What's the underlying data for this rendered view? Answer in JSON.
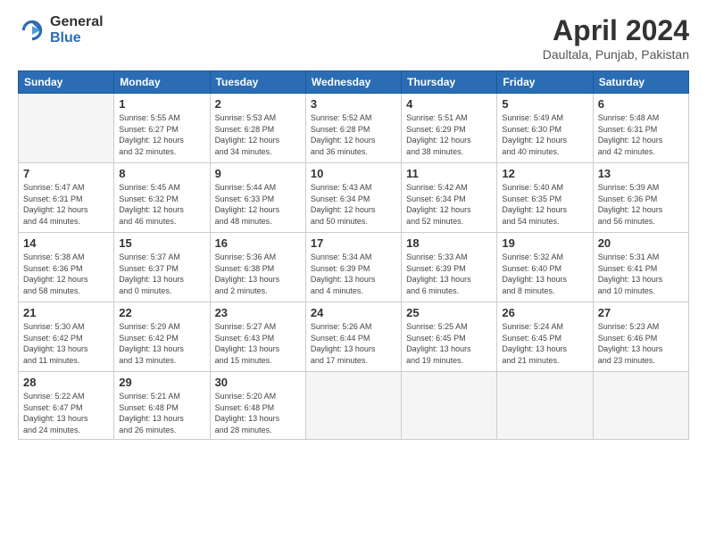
{
  "logo": {
    "general": "General",
    "blue": "Blue"
  },
  "header": {
    "title": "April 2024",
    "location": "Daultala, Punjab, Pakistan"
  },
  "weekdays": [
    "Sunday",
    "Monday",
    "Tuesday",
    "Wednesday",
    "Thursday",
    "Friday",
    "Saturday"
  ],
  "weeks": [
    [
      {
        "day": "",
        "info": ""
      },
      {
        "day": "1",
        "info": "Sunrise: 5:55 AM\nSunset: 6:27 PM\nDaylight: 12 hours\nand 32 minutes."
      },
      {
        "day": "2",
        "info": "Sunrise: 5:53 AM\nSunset: 6:28 PM\nDaylight: 12 hours\nand 34 minutes."
      },
      {
        "day": "3",
        "info": "Sunrise: 5:52 AM\nSunset: 6:28 PM\nDaylight: 12 hours\nand 36 minutes."
      },
      {
        "day": "4",
        "info": "Sunrise: 5:51 AM\nSunset: 6:29 PM\nDaylight: 12 hours\nand 38 minutes."
      },
      {
        "day": "5",
        "info": "Sunrise: 5:49 AM\nSunset: 6:30 PM\nDaylight: 12 hours\nand 40 minutes."
      },
      {
        "day": "6",
        "info": "Sunrise: 5:48 AM\nSunset: 6:31 PM\nDaylight: 12 hours\nand 42 minutes."
      }
    ],
    [
      {
        "day": "7",
        "info": "Sunrise: 5:47 AM\nSunset: 6:31 PM\nDaylight: 12 hours\nand 44 minutes."
      },
      {
        "day": "8",
        "info": "Sunrise: 5:45 AM\nSunset: 6:32 PM\nDaylight: 12 hours\nand 46 minutes."
      },
      {
        "day": "9",
        "info": "Sunrise: 5:44 AM\nSunset: 6:33 PM\nDaylight: 12 hours\nand 48 minutes."
      },
      {
        "day": "10",
        "info": "Sunrise: 5:43 AM\nSunset: 6:34 PM\nDaylight: 12 hours\nand 50 minutes."
      },
      {
        "day": "11",
        "info": "Sunrise: 5:42 AM\nSunset: 6:34 PM\nDaylight: 12 hours\nand 52 minutes."
      },
      {
        "day": "12",
        "info": "Sunrise: 5:40 AM\nSunset: 6:35 PM\nDaylight: 12 hours\nand 54 minutes."
      },
      {
        "day": "13",
        "info": "Sunrise: 5:39 AM\nSunset: 6:36 PM\nDaylight: 12 hours\nand 56 minutes."
      }
    ],
    [
      {
        "day": "14",
        "info": "Sunrise: 5:38 AM\nSunset: 6:36 PM\nDaylight: 12 hours\nand 58 minutes."
      },
      {
        "day": "15",
        "info": "Sunrise: 5:37 AM\nSunset: 6:37 PM\nDaylight: 13 hours\nand 0 minutes."
      },
      {
        "day": "16",
        "info": "Sunrise: 5:36 AM\nSunset: 6:38 PM\nDaylight: 13 hours\nand 2 minutes."
      },
      {
        "day": "17",
        "info": "Sunrise: 5:34 AM\nSunset: 6:39 PM\nDaylight: 13 hours\nand 4 minutes."
      },
      {
        "day": "18",
        "info": "Sunrise: 5:33 AM\nSunset: 6:39 PM\nDaylight: 13 hours\nand 6 minutes."
      },
      {
        "day": "19",
        "info": "Sunrise: 5:32 AM\nSunset: 6:40 PM\nDaylight: 13 hours\nand 8 minutes."
      },
      {
        "day": "20",
        "info": "Sunrise: 5:31 AM\nSunset: 6:41 PM\nDaylight: 13 hours\nand 10 minutes."
      }
    ],
    [
      {
        "day": "21",
        "info": "Sunrise: 5:30 AM\nSunset: 6:42 PM\nDaylight: 13 hours\nand 11 minutes."
      },
      {
        "day": "22",
        "info": "Sunrise: 5:29 AM\nSunset: 6:42 PM\nDaylight: 13 hours\nand 13 minutes."
      },
      {
        "day": "23",
        "info": "Sunrise: 5:27 AM\nSunset: 6:43 PM\nDaylight: 13 hours\nand 15 minutes."
      },
      {
        "day": "24",
        "info": "Sunrise: 5:26 AM\nSunset: 6:44 PM\nDaylight: 13 hours\nand 17 minutes."
      },
      {
        "day": "25",
        "info": "Sunrise: 5:25 AM\nSunset: 6:45 PM\nDaylight: 13 hours\nand 19 minutes."
      },
      {
        "day": "26",
        "info": "Sunrise: 5:24 AM\nSunset: 6:45 PM\nDaylight: 13 hours\nand 21 minutes."
      },
      {
        "day": "27",
        "info": "Sunrise: 5:23 AM\nSunset: 6:46 PM\nDaylight: 13 hours\nand 23 minutes."
      }
    ],
    [
      {
        "day": "28",
        "info": "Sunrise: 5:22 AM\nSunset: 6:47 PM\nDaylight: 13 hours\nand 24 minutes."
      },
      {
        "day": "29",
        "info": "Sunrise: 5:21 AM\nSunset: 6:48 PM\nDaylight: 13 hours\nand 26 minutes."
      },
      {
        "day": "30",
        "info": "Sunrise: 5:20 AM\nSunset: 6:48 PM\nDaylight: 13 hours\nand 28 minutes."
      },
      {
        "day": "",
        "info": ""
      },
      {
        "day": "",
        "info": ""
      },
      {
        "day": "",
        "info": ""
      },
      {
        "day": "",
        "info": ""
      }
    ]
  ]
}
